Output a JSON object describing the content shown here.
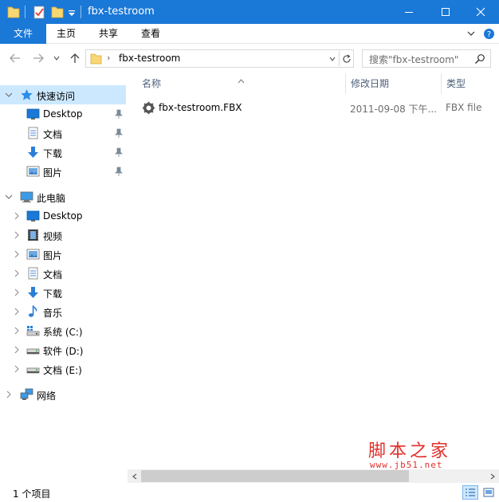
{
  "window": {
    "title": "fbx-testroom"
  },
  "ribbon": {
    "tabs": [
      {
        "label": "文件"
      },
      {
        "label": "主页"
      },
      {
        "label": "共享"
      },
      {
        "label": "查看"
      }
    ]
  },
  "address": {
    "path": "fbx-testroom",
    "search_placeholder": "搜索\"fbx-testroom\""
  },
  "sidebar": {
    "quick_access": {
      "label": "快速访问",
      "items": [
        {
          "label": "Desktop",
          "icon": "desktop-icon",
          "pinned": true
        },
        {
          "label": "文档",
          "icon": "document-icon",
          "pinned": true
        },
        {
          "label": "下载",
          "icon": "download-icon",
          "pinned": true
        },
        {
          "label": "图片",
          "icon": "pictures-icon",
          "pinned": true
        }
      ]
    },
    "this_pc": {
      "label": "此电脑",
      "items": [
        {
          "label": "Desktop",
          "icon": "desktop-icon"
        },
        {
          "label": "视频",
          "icon": "video-icon"
        },
        {
          "label": "图片",
          "icon": "pictures-icon"
        },
        {
          "label": "文档",
          "icon": "document-icon"
        },
        {
          "label": "下载",
          "icon": "download-icon"
        },
        {
          "label": "音乐",
          "icon": "music-icon"
        },
        {
          "label": "系统 (C:)",
          "icon": "system-drive-icon"
        },
        {
          "label": "软件 (D:)",
          "icon": "drive-icon"
        },
        {
          "label": "文档 (E:)",
          "icon": "drive-icon"
        }
      ]
    },
    "network": {
      "label": "网络"
    }
  },
  "files": {
    "columns": {
      "name": "名称",
      "date": "修改日期",
      "type": "类型"
    },
    "rows": [
      {
        "name": "fbx-testroom.FBX",
        "date": "2011-09-08 下午...",
        "type": "FBX file"
      }
    ]
  },
  "watermark": {
    "main": "脚本之家",
    "url": "www.jb51.net"
  },
  "status": {
    "item_count": "1 个项目"
  },
  "colors": {
    "accent": "#1a78d7",
    "selection": "#cce8ff",
    "watermark": "#e0302b"
  }
}
